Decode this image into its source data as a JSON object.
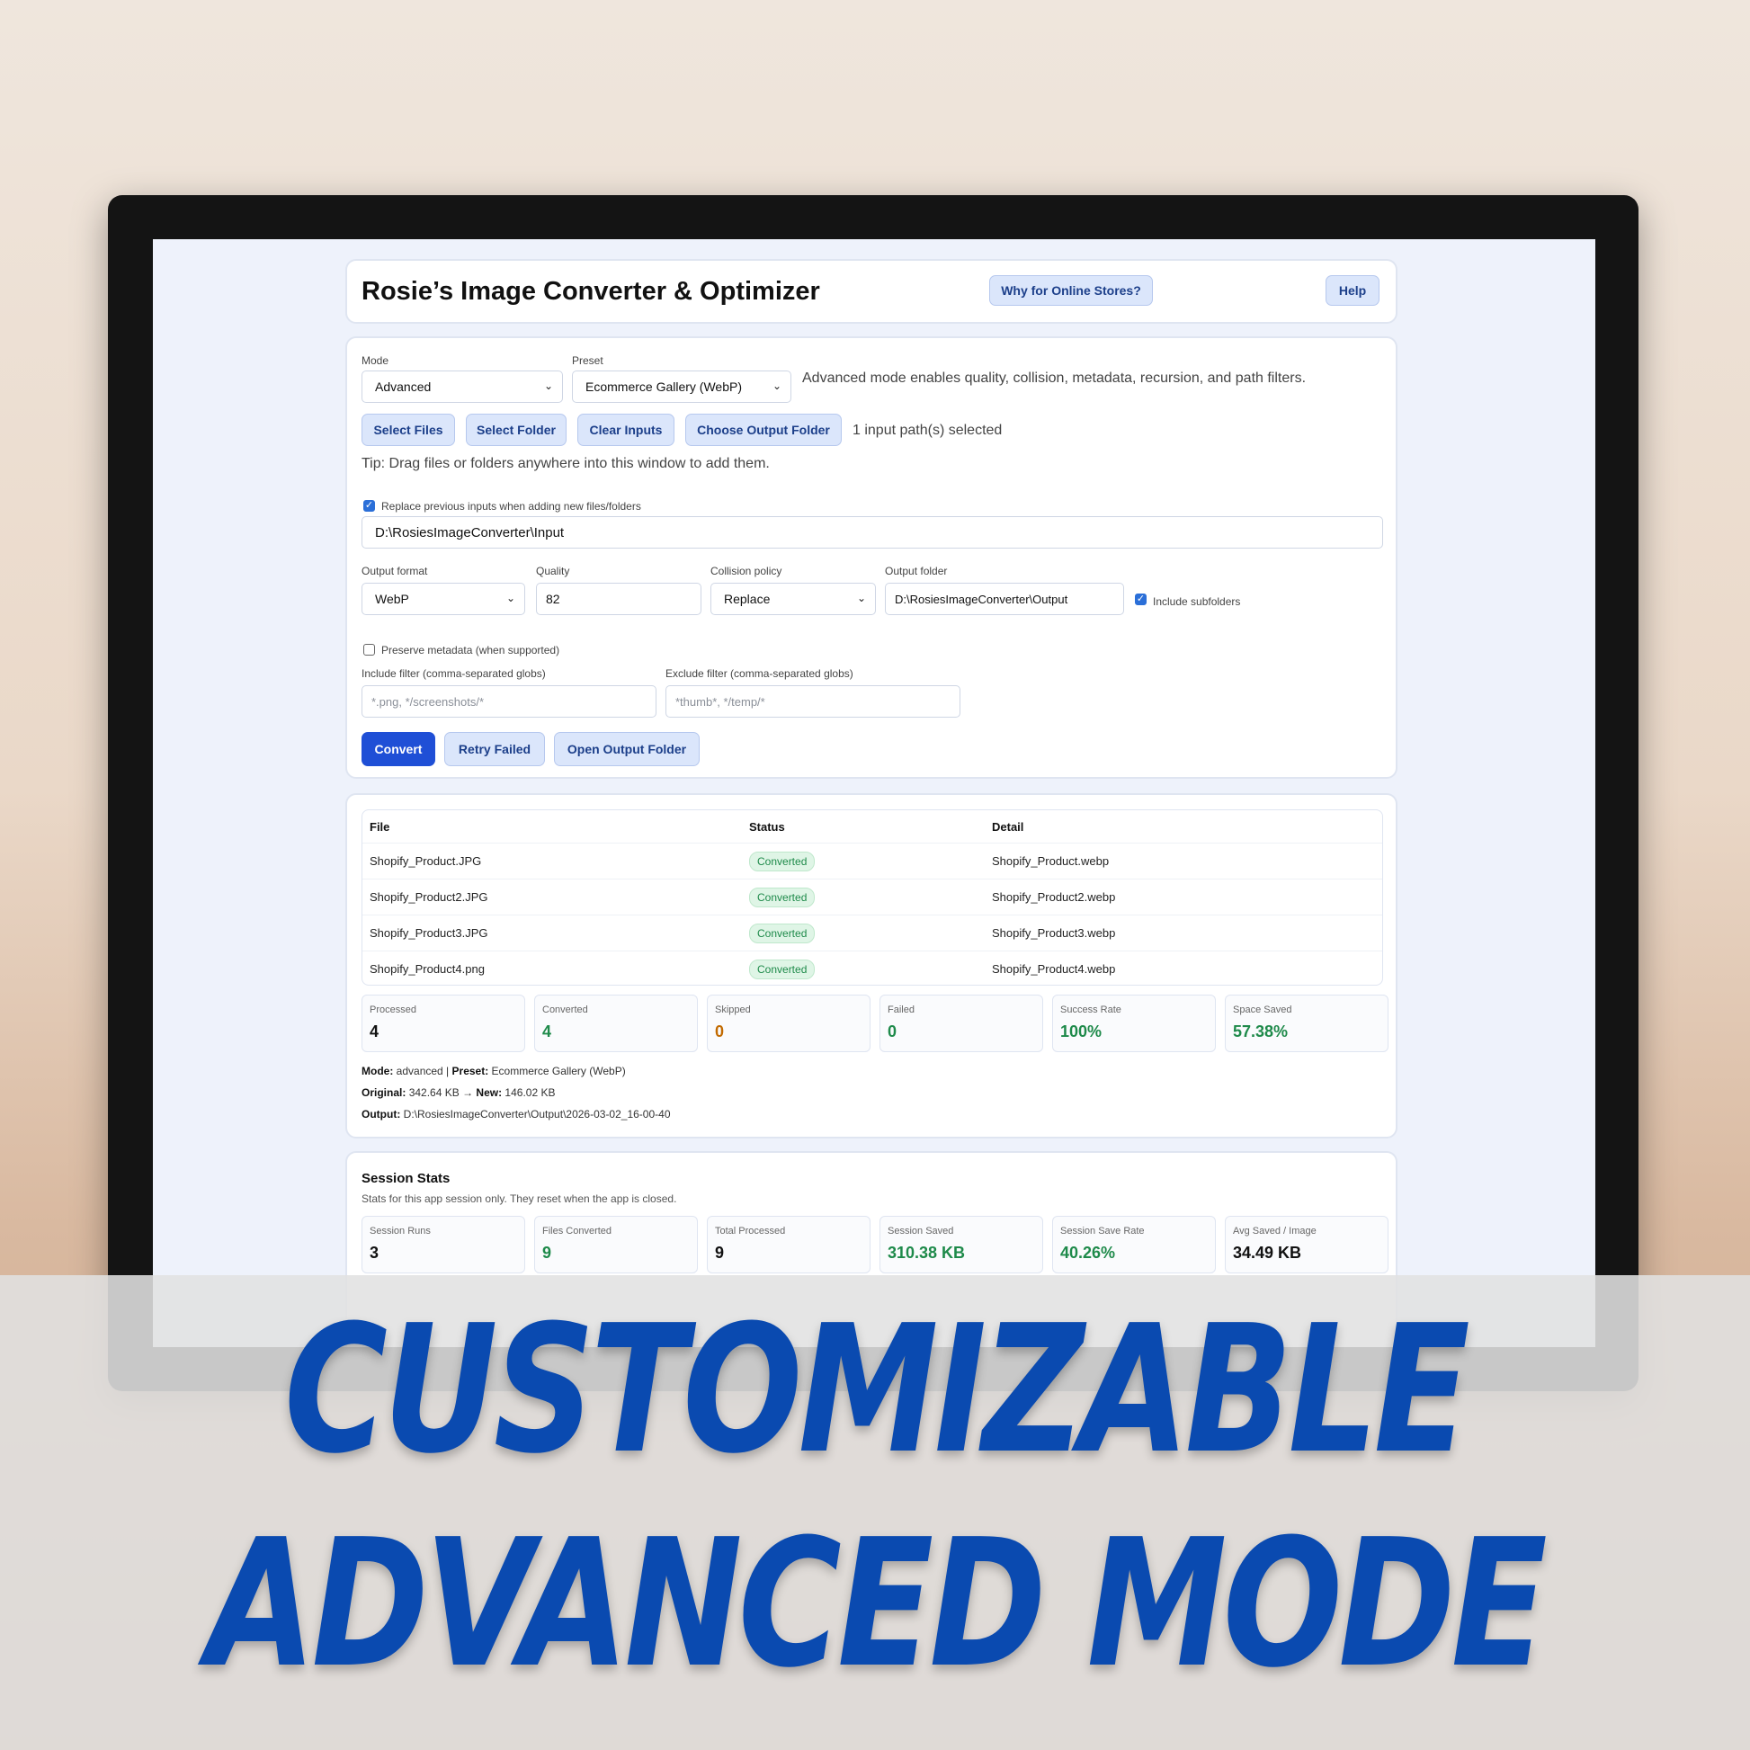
{
  "app": {
    "title": "Rosie’s Image Converter & Optimizer",
    "why_button": "Why for Online Stores?",
    "help_button": "Help"
  },
  "settings": {
    "mode_label": "Mode",
    "mode_value": "Advanced",
    "preset_label": "Preset",
    "preset_value": "Ecommerce Gallery (WebP)",
    "advanced_note": "Advanced mode enables quality, collision, metadata, recursion, and path filters.",
    "buttons": {
      "select_files": "Select Files",
      "select_folder": "Select Folder",
      "clear_inputs": "Clear Inputs",
      "choose_output": "Choose Output Folder"
    },
    "input_count": "1 input path(s) selected",
    "tip": "Tip: Drag files or folders anywhere into this window to add them.",
    "replace_label": "Replace previous inputs when adding new files/folders",
    "input_path": "D:\\RosiesImageConverter\\Input",
    "output_format_label": "Output format",
    "output_format_value": "WebP",
    "quality_label": "Quality",
    "quality_value": "82",
    "collision_label": "Collision policy",
    "collision_value": "Replace",
    "output_folder_label": "Output folder",
    "output_folder_value": "D:\\RosiesImageConverter\\Output",
    "include_subfolders": "Include subfolders",
    "preserve_metadata": "Preserve metadata (when supported)",
    "include_filter_label": "Include filter (comma-separated globs)",
    "include_filter_placeholder": "*.png, */screenshots/*",
    "exclude_filter_label": "Exclude filter (comma-separated globs)",
    "exclude_filter_placeholder": "*thumb*, */temp/*",
    "convert": "Convert",
    "retry": "Retry Failed",
    "open_output": "Open Output Folder"
  },
  "results": {
    "headers": [
      "File",
      "Status",
      "Detail"
    ],
    "rows": [
      {
        "file": "Shopify_Product.JPG",
        "status": "Converted",
        "detail": "Shopify_Product.webp"
      },
      {
        "file": "Shopify_Product2.JPG",
        "status": "Converted",
        "detail": "Shopify_Product2.webp"
      },
      {
        "file": "Shopify_Product3.JPG",
        "status": "Converted",
        "detail": "Shopify_Product3.webp"
      },
      {
        "file": "Shopify_Product4.png",
        "status": "Converted",
        "detail": "Shopify_Product4.webp"
      }
    ],
    "stats": [
      {
        "label": "Processed",
        "value": "4",
        "color": "#111111"
      },
      {
        "label": "Converted",
        "value": "4",
        "color": "#1e8a4a"
      },
      {
        "label": "Skipped",
        "value": "0",
        "color": "#c26a00"
      },
      {
        "label": "Failed",
        "value": "0",
        "color": "#1e8a4a"
      },
      {
        "label": "Success Rate",
        "value": "100%",
        "color": "#1e8a4a"
      },
      {
        "label": "Space Saved",
        "value": "57.38%",
        "color": "#1e8a4a"
      }
    ],
    "mode_key": "Mode:",
    "mode_val": "advanced",
    "preset_key": "Preset:",
    "preset_val": "Ecommerce Gallery (WebP)",
    "original_key": "Original:",
    "original_val": "342.64 KB",
    "new_key": "New:",
    "new_val": "146.02 KB",
    "output_key": "Output:",
    "output_val": "D:\\RosiesImageConverter\\Output\\2026-03-02_16-00-40"
  },
  "session": {
    "title": "Session Stats",
    "subtitle": "Stats for this app session only. They reset when the app is closed.",
    "stats": [
      {
        "label": "Session Runs",
        "value": "3",
        "color": "#111111"
      },
      {
        "label": "Files Converted",
        "value": "9",
        "color": "#1e8a4a"
      },
      {
        "label": "Total Processed",
        "value": "9",
        "color": "#111111"
      },
      {
        "label": "Session Saved",
        "value": "310.38 KB",
        "color": "#1e8a4a"
      },
      {
        "label": "Session Save Rate",
        "value": "40.26%",
        "color": "#1e8a4a"
      },
      {
        "label": "Avg Saved / Image",
        "value": "34.49 KB",
        "color": "#111111"
      }
    ]
  },
  "banner": {
    "line1": "CUSTOMIZABLE",
    "line2": "ADVANCED MODE",
    "color": "#0a4ab0"
  }
}
